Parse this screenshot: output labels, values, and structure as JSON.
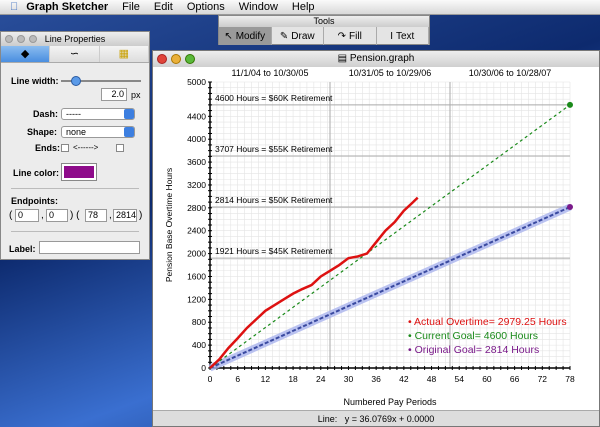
{
  "menubar": {
    "app": "Graph Sketcher",
    "items": [
      "File",
      "Edit",
      "Options",
      "Window",
      "Help"
    ]
  },
  "tools": {
    "title": "Tools",
    "buttons": [
      "Modify",
      "Draw",
      "Fill",
      "Text"
    ],
    "selected": "Modify"
  },
  "line_properties": {
    "title": "Line Properties",
    "line_width_label": "Line width:",
    "line_width": "2.0",
    "px": "px",
    "line_width_slider": 0.2,
    "dash_label": "Dash:",
    "dash": "-----",
    "shape_label": "Shape:",
    "shape": "none",
    "ends_label": "Ends:",
    "ends_arrow": "<------>",
    "color_label": "Line color:",
    "color": "#8e0b8a",
    "endpoints_label": "Endpoints:",
    "endpoints": [
      "0",
      "0",
      "78",
      "2814"
    ],
    "label_label": "Label:",
    "label_value": ""
  },
  "graph": {
    "title": "Pension.graph",
    "status_label": "Line:",
    "status_eq": "y = 36.0769x + 0.0000"
  },
  "chart_data": {
    "type": "line",
    "xlabel": "Numbered Pay Periods",
    "ylabel": "Pension Base Overtime Hours",
    "xlim": [
      0,
      78
    ],
    "ylim": [
      0,
      5000
    ],
    "xticks": [
      0,
      6,
      12,
      18,
      24,
      30,
      36,
      42,
      48,
      54,
      60,
      66,
      72,
      78
    ],
    "yticks": [
      0,
      400,
      800,
      1200,
      1600,
      2000,
      2400,
      2800,
      3200,
      3600,
      4000,
      4400,
      5000
    ],
    "period_labels": [
      "11/1/04 to 10/30/05",
      "10/31/05 to 10/29/06",
      "10/30/06 to 10/28/07"
    ],
    "period_dividers": [
      26,
      52
    ],
    "reference_lines": [
      {
        "y": 4600,
        "label": "4600 Hours = $60K Retirement"
      },
      {
        "y": 3707,
        "label": "3707 Hours = $55K Retirement"
      },
      {
        "y": 2814,
        "label": "2814 Hours = $50K Retirement"
      },
      {
        "y": 1921,
        "label": "1921 Hours = $45K Retirement"
      }
    ],
    "series": [
      {
        "name": "Actual Overtime",
        "legend": "Actual Overtime= 2979.25 Hours",
        "color": "#dd1111",
        "x": [
          0,
          2,
          4,
          6,
          8,
          10,
          12,
          14,
          16,
          18,
          20,
          22,
          24,
          26,
          28,
          30,
          32,
          34,
          36,
          38,
          40,
          42,
          44,
          45
        ],
        "y": [
          0,
          150,
          350,
          520,
          700,
          850,
          1000,
          1100,
          1200,
          1300,
          1380,
          1450,
          1600,
          1700,
          1800,
          1920,
          1950,
          2000,
          2200,
          2400,
          2550,
          2750,
          2900,
          2979
        ]
      },
      {
        "name": "Current Goal",
        "legend": "Current Goal= 4600 Hours",
        "color": "#1a8a1a",
        "x": [
          0,
          78
        ],
        "y": [
          0,
          4600
        ]
      },
      {
        "name": "Original Goal",
        "legend": "Original Goal= 2814 Hours",
        "color": "#7a1a8a",
        "x": [
          0,
          78
        ],
        "y": [
          0,
          2814
        ]
      }
    ]
  }
}
